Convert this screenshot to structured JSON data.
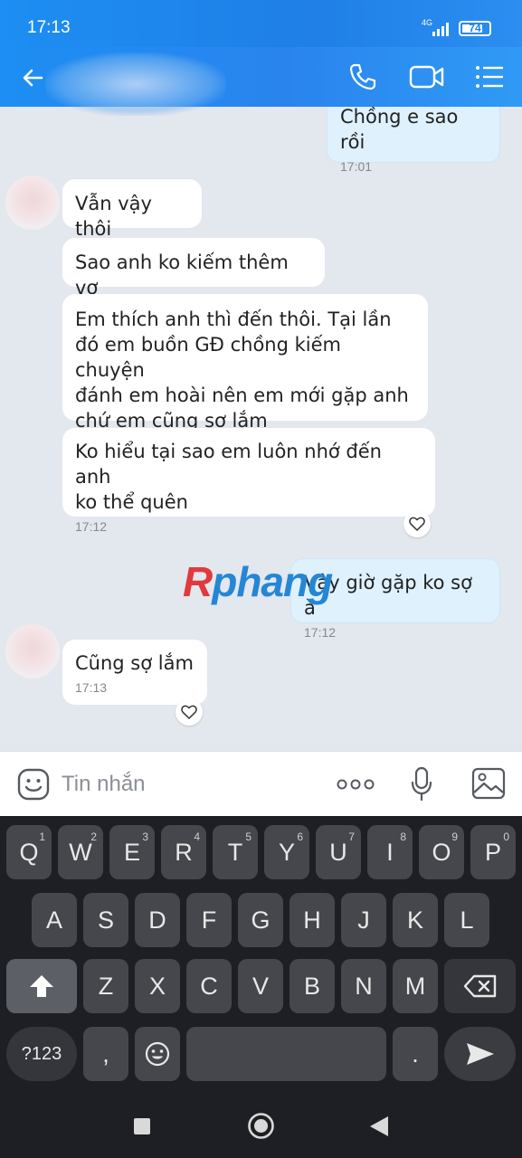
{
  "status_bar": {
    "time": "17:13",
    "network": "4G",
    "battery": "74"
  },
  "header": {
    "contact_name_blurred": true
  },
  "messages": [
    {
      "dir": "out",
      "text": "Chồng e sao rồi",
      "time": "17:01"
    },
    {
      "dir": "in",
      "text": "Vẫn vậy thôi"
    },
    {
      "dir": "in",
      "text": "Sao anh ko kiếm thêm vợ"
    },
    {
      "dir": "in",
      "lines": [
        "Em thích anh thì đến thôi. Tại lần",
        "đó em buồn GĐ chồng kiếm chuyện",
        "đánh em hoài nên em mới gặp anh",
        "chứ em cũng sợ lắm"
      ]
    },
    {
      "dir": "in",
      "lines": [
        "Ko hiểu tại sao em luôn nhớ đến anh",
        "ko thể quên"
      ],
      "time": "17:12"
    },
    {
      "dir": "out",
      "text": "Vậy giờ gặp ko sợ à",
      "time": "17:12"
    },
    {
      "dir": "in",
      "text": "Cũng sợ lắm",
      "time": "17:13"
    }
  ],
  "watermark": {
    "first": "R",
    "rest": "phang"
  },
  "input": {
    "placeholder": "Tin nhắn"
  },
  "keyboard": {
    "row1": [
      "Q",
      "W",
      "E",
      "R",
      "T",
      "Y",
      "U",
      "I",
      "O",
      "P"
    ],
    "row1_hints": [
      "1",
      "2",
      "3",
      "4",
      "5",
      "6",
      "7",
      "8",
      "9",
      "0"
    ],
    "row2": [
      "A",
      "S",
      "D",
      "F",
      "G",
      "H",
      "J",
      "K",
      "L"
    ],
    "row3": [
      "Z",
      "X",
      "C",
      "V",
      "B",
      "N",
      "M"
    ],
    "numbers_key": "?123",
    "comma_key": ",",
    "period_key": "."
  },
  "colors": {
    "header": "#1f7fe6",
    "outgoing_bubble": "#def1fc",
    "incoming_bubble": "#ffffff",
    "chat_bg": "#e3e7ee",
    "keyboard_bg": "#1d1f24"
  }
}
